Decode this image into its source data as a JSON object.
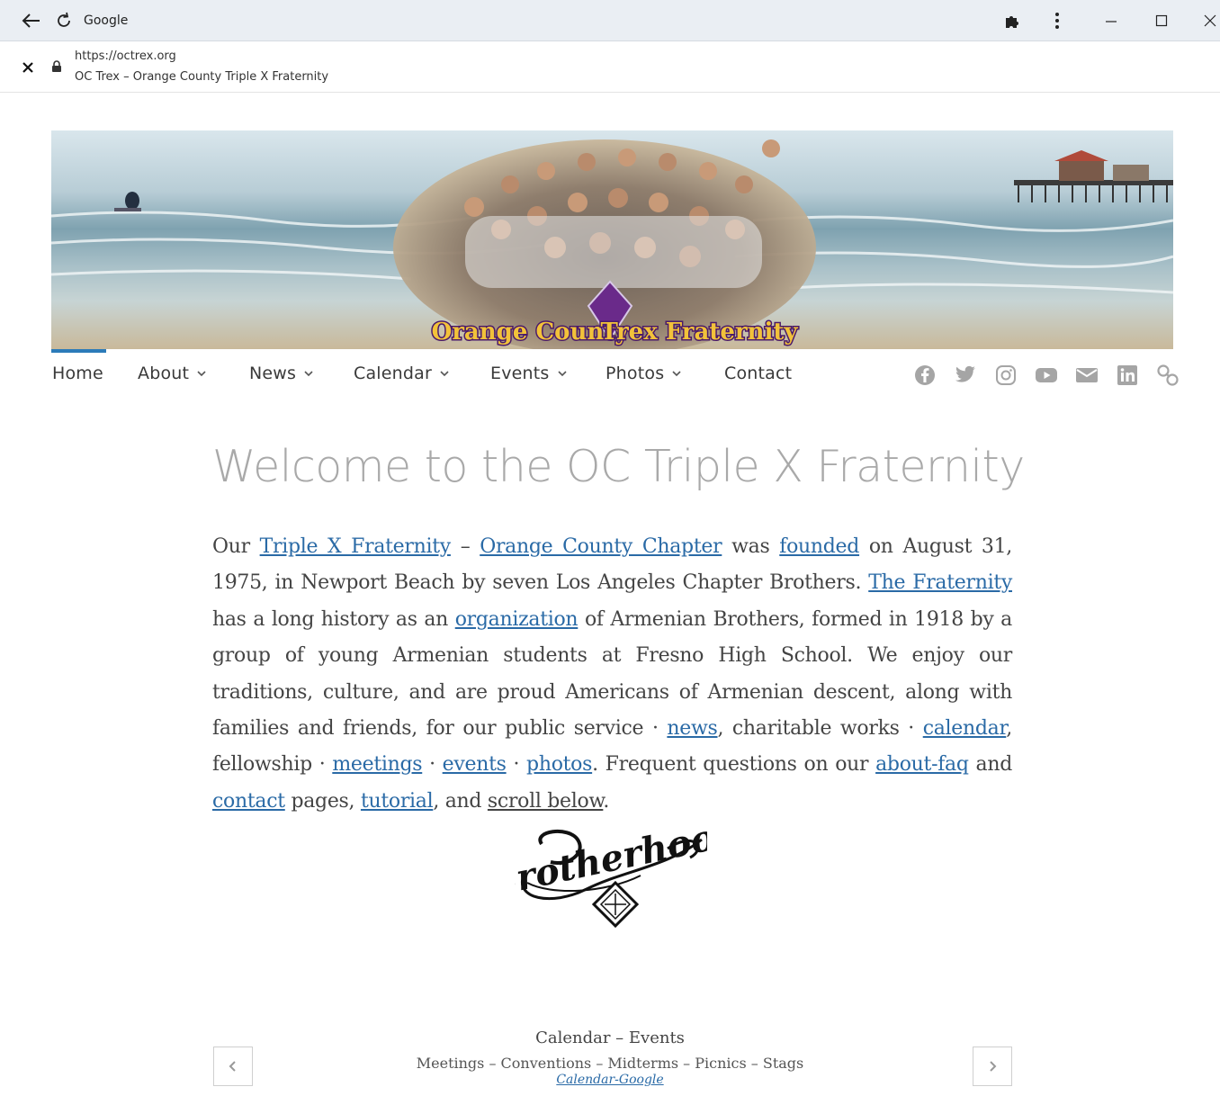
{
  "browser": {
    "tab_title": "Google",
    "url": "https://octrex.org",
    "page_title": "OC Trex – Orange County Triple X Fraternity"
  },
  "hero": {
    "banner_text_left": "Orange County",
    "banner_text_right": "Trex Fraternity"
  },
  "nav": {
    "items": [
      {
        "label": "Home",
        "has_dropdown": false,
        "active": true
      },
      {
        "label": "About",
        "has_dropdown": true
      },
      {
        "label": "News",
        "has_dropdown": true
      },
      {
        "label": "Calendar",
        "has_dropdown": true
      },
      {
        "label": "Events",
        "has_dropdown": true
      },
      {
        "label": "Photos",
        "has_dropdown": true
      },
      {
        "label": "Contact",
        "has_dropdown": false
      }
    ],
    "social_icons": [
      "facebook-icon",
      "twitter-icon",
      "instagram-icon",
      "youtube-icon",
      "email-icon",
      "linkedin-icon",
      "link-icon"
    ],
    "accent_color": "#2b7bb9"
  },
  "main": {
    "title": "Welcome to the OC Triple X Fraternity",
    "intro": {
      "t1": "Our ",
      "l1": "Triple X Fraternity",
      "t2": " – ",
      "l2": "Orange County Chapter",
      "t3": " was ",
      "l3": "founded",
      "t4": " on August 31, 1975, in Newport Beach by seven Los Angeles Chapter Brothers. ",
      "l4": "The Fraternity",
      "t5": " has a long history as an ",
      "l5": "organization",
      "t6": " of Armenian Brothers, formed in 1918 by a group of young Armenian students at Fresno High School. We enjoy our traditions, culture, and are proud Americans of Armenian descent, along with families and friends, for our public service · ",
      "l6": "news",
      "t7": ", charitable works · ",
      "l7": "calendar",
      "t8": ", fellowship · ",
      "l8": "meetings",
      "t9": " · ",
      "l9": "events",
      "t10": " · ",
      "l10": "photos",
      "t11": ". Frequent questions on our ",
      "l11": "about-faq",
      "t12": " and ",
      "l12": "contact",
      "t13": " pages, ",
      "l13": "tutorial",
      "t14": ", and ",
      "l14": "scroll below",
      "t15": "."
    },
    "logo_text": "Brotherhood"
  },
  "calendar": {
    "title": "Calendar – Events",
    "subtitle": "Meetings – Conventions – Midterms – Picnics – Stags",
    "link": "Calendar-Google"
  },
  "link_color": "#2a6aa6"
}
